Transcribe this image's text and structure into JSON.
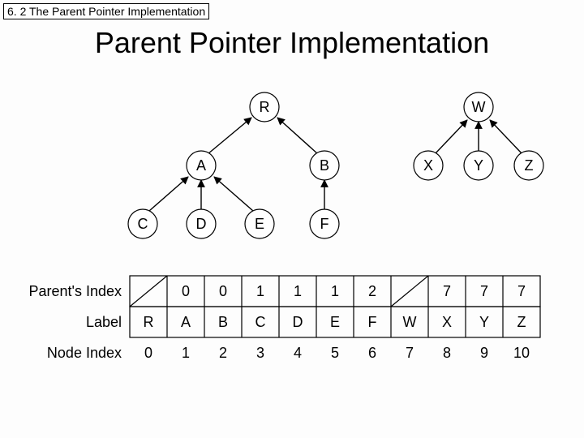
{
  "breadcrumb": "6. 2 The Parent Pointer Implementation",
  "title": "Parent Pointer Implementation",
  "nodes": {
    "R": "R",
    "W": "W",
    "A": "A",
    "B": "B",
    "X": "X",
    "Y": "Y",
    "Z": "Z",
    "C": "C",
    "D": "D",
    "E": "E",
    "F": "F"
  },
  "rows": {
    "parent_label": "Parent's Index",
    "label_label": "Label",
    "index_label": "Node Index",
    "columns": [
      {
        "parent": "/",
        "label": "R",
        "index": "0"
      },
      {
        "parent": "0",
        "label": "A",
        "index": "1"
      },
      {
        "parent": "0",
        "label": "B",
        "index": "2"
      },
      {
        "parent": "1",
        "label": "C",
        "index": "3"
      },
      {
        "parent": "1",
        "label": "D",
        "index": "4"
      },
      {
        "parent": "1",
        "label": "E",
        "index": "5"
      },
      {
        "parent": "2",
        "label": "F",
        "index": "6"
      },
      {
        "parent": "/",
        "label": "W",
        "index": "7"
      },
      {
        "parent": "7",
        "label": "X",
        "index": "8"
      },
      {
        "parent": "7",
        "label": "Y",
        "index": "9"
      },
      {
        "parent": "7",
        "label": "Z",
        "index": "10"
      }
    ]
  },
  "chart_data": {
    "type": "table",
    "title": "Parent Pointer Implementation",
    "columns": [
      "Node Index",
      "Label",
      "Parent's Index"
    ],
    "rows": [
      [
        0,
        "R",
        null
      ],
      [
        1,
        "A",
        0
      ],
      [
        2,
        "B",
        0
      ],
      [
        3,
        "C",
        1
      ],
      [
        4,
        "D",
        1
      ],
      [
        5,
        "E",
        1
      ],
      [
        6,
        "F",
        2
      ],
      [
        7,
        "W",
        null
      ],
      [
        8,
        "X",
        7
      ],
      [
        9,
        "Y",
        7
      ],
      [
        10,
        "Z",
        7
      ]
    ],
    "trees": [
      {
        "root": "R",
        "edges": [
          [
            "A",
            "R"
          ],
          [
            "B",
            "R"
          ],
          [
            "C",
            "A"
          ],
          [
            "D",
            "A"
          ],
          [
            "E",
            "A"
          ],
          [
            "F",
            "B"
          ]
        ]
      },
      {
        "root": "W",
        "edges": [
          [
            "X",
            "W"
          ],
          [
            "Y",
            "W"
          ],
          [
            "Z",
            "W"
          ]
        ]
      }
    ]
  }
}
